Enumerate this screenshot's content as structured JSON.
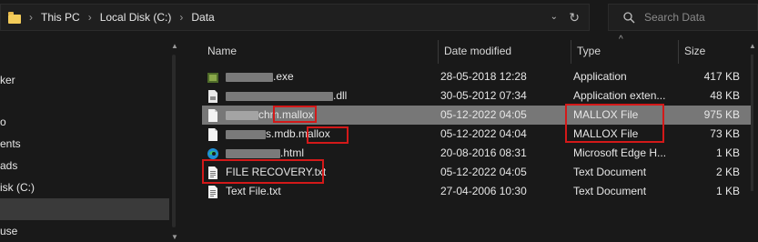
{
  "address_bar": {
    "crumbs": [
      "This PC",
      "Local Disk (C:)",
      "Data"
    ]
  },
  "search": {
    "placeholder": "Search Data"
  },
  "nav": {
    "items": [
      "ker",
      "o",
      "ents",
      "ads",
      "isk (C:)",
      "",
      "use"
    ]
  },
  "columns": {
    "name": "Name",
    "date": "Date modified",
    "type": "Type",
    "size": "Size"
  },
  "files": [
    {
      "name_visible": ".exe",
      "date": "28-05-2018 12:28",
      "type": "Application",
      "size": "417 KB",
      "icon": "exe-icon"
    },
    {
      "name_visible": ".dll",
      "date": "30-05-2012 07:34",
      "type": "Application exten...",
      "size": "48 KB",
      "icon": "dll-icon"
    },
    {
      "name_visible": "chm",
      "name_ext": ".mallox",
      "date": "05-12-2022 04:05",
      "type": "MALLOX File",
      "size": "975 KB",
      "icon": "file-icon"
    },
    {
      "name_visible": "s.mdb",
      "name_ext": ".mallox",
      "date": "05-12-2022 04:04",
      "type": "MALLOX File",
      "size": "73 KB",
      "icon": "file-icon"
    },
    {
      "name_visible": ".html",
      "date": "20-08-2016 08:31",
      "type": "Microsoft Edge H...",
      "size": "1 KB",
      "icon": "edge-icon"
    },
    {
      "name_visible": "FILE RECOVERY.txt",
      "date": "05-12-2022 04:05",
      "type": "Text Document",
      "size": "2 KB",
      "icon": "text-icon"
    },
    {
      "name_visible": "Text File.txt",
      "date": "27-04-2006 10:30",
      "type": "Text Document",
      "size": "1 KB",
      "icon": "text-icon"
    }
  ],
  "colors": {
    "background": "#191919",
    "selected_row": "#777777",
    "annotation": "#d31919",
    "folder": "#f4cc5a"
  }
}
